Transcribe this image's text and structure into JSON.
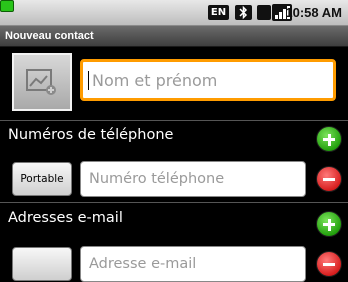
{
  "status_bar": {
    "keyboard_indicator": "EN",
    "time": "10:58 AM",
    "icons": [
      "keyboard-indicator-icon",
      "bluetooth-icon",
      "hm-icon",
      "signal-icon",
      "battery-icon"
    ],
    "battery_color": "#29c41a"
  },
  "title_bar": {
    "title": "Nouveau contact"
  },
  "photo": {
    "icon": "contact-photo-placeholder-icon"
  },
  "name_field": {
    "placeholder": "Nom et prénom",
    "value": "",
    "focus_color": "#ff9c00"
  },
  "phone_section": {
    "label": "Numéros de téléphone",
    "add_icon": "add-icon",
    "entries": [
      {
        "type_label": "Portable",
        "placeholder": "Numéro téléphone",
        "value": "",
        "remove_icon": "remove-icon"
      }
    ]
  },
  "email_section": {
    "label": "Adresses e-mail",
    "add_icon": "add-icon",
    "entries": [
      {
        "type_label": "",
        "placeholder": "Adresse e-mail",
        "value": "",
        "remove_icon": "remove-icon"
      }
    ]
  },
  "colors": {
    "add": "#23a10d",
    "remove": "#d81f1f",
    "background": "#000000"
  }
}
